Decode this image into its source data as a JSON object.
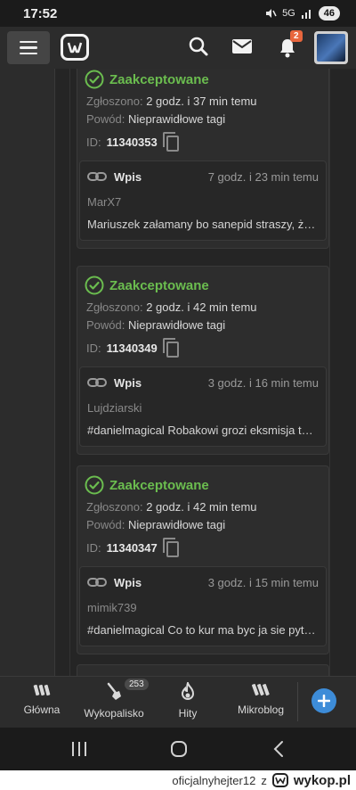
{
  "status_bar": {
    "time": "17:52",
    "network": "5G",
    "battery": "46"
  },
  "topnav": {
    "notifications_count": "2"
  },
  "reports": [
    {
      "status": "Zaakceptowane",
      "reported_label": "Zgłoszono:",
      "reported_value": "2 godz. i 37 min temu",
      "reason_label": "Powód:",
      "reason_value": "Nieprawidłowe tagi",
      "id_label": "ID:",
      "id_value": "11340353",
      "entry": {
        "type": "Wpis",
        "time": "7 godz. i 23 min temu",
        "author": "MarX7",
        "text": "Mariuszek załamany bo sanepid straszy, że j..."
      }
    },
    {
      "status": "Zaakceptowane",
      "reported_label": "Zgłoszono:",
      "reported_value": "2 godz. i 42 min temu",
      "reason_label": "Powód:",
      "reason_value": "Nieprawidłowe tagi",
      "id_label": "ID:",
      "id_value": "11340349",
      "entry": {
        "type": "Wpis",
        "time": "3 godz. i 16 min temu",
        "author": "Lujdziarski",
        "text": "#danielmagical Robakowi grozi eksmisja tak..."
      }
    },
    {
      "status": "Zaakceptowane",
      "reported_label": "Zgłoszono:",
      "reported_value": "2 godz. i 42 min temu",
      "reason_label": "Powód:",
      "reason_value": "Nieprawidłowe tagi",
      "id_label": "ID:",
      "id_value": "11340347",
      "entry": {
        "type": "Wpis",
        "time": "3 godz. i 15 min temu",
        "author": "mimik739",
        "text": "#danielmagical Co to kur ma byc ja sie pyta..."
      }
    }
  ],
  "bottomnav": {
    "items": [
      {
        "label": "Główna"
      },
      {
        "label": "Wykopalisko"
      },
      {
        "label": "Hity"
      },
      {
        "label": "Mikroblog"
      }
    ],
    "wykopalisko_badge": "253"
  },
  "watermark": {
    "user": "oficjalnyhejter12",
    "z": "z",
    "site": "wykop.pl"
  },
  "colors": {
    "accent_green": "#6bbd4f",
    "badge_orange": "#e8663d",
    "fab_blue": "#3d8cd8"
  }
}
